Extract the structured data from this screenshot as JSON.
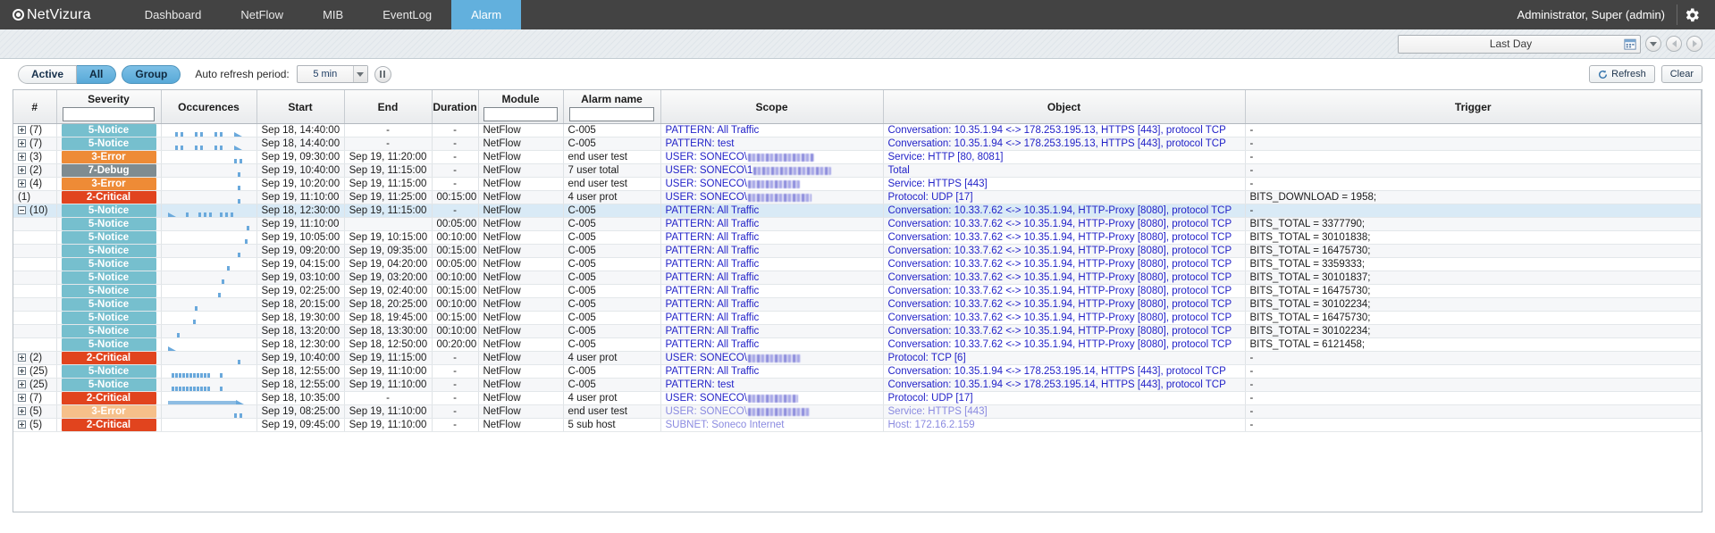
{
  "navbar": {
    "brand": "NetVizura",
    "logo_icon": "eye-logo-icon",
    "tabs": [
      {
        "label": "Dashboard",
        "active": false
      },
      {
        "label": "NetFlow",
        "active": false
      },
      {
        "label": "MIB",
        "active": false
      },
      {
        "label": "EventLog",
        "active": false
      },
      {
        "label": "Alarm",
        "active": true
      }
    ],
    "user": "Administrator, Super (admin)",
    "gear_icon": "gear-icon",
    "accent_color": "#62b0dd",
    "background_color": "#434343"
  },
  "subheader": {
    "time_range": "Last Day",
    "calendar_icon": "calendar-icon",
    "dropdown_icon": "chevron-down-icon",
    "prev_icon": "prev-arrow-icon",
    "next_icon": "next-arrow-icon"
  },
  "toolbar": {
    "filters": [
      {
        "label": "Active",
        "active": false
      },
      {
        "label": "All",
        "active": true
      },
      {
        "label": "Group",
        "active": true
      }
    ],
    "auto_refresh_label": "Auto refresh period:",
    "auto_refresh_value": "5 min",
    "pause_icon": "pause-icon",
    "refresh_button": "Refresh",
    "refresh_icon": "refresh-icon",
    "clear_button": "Clear"
  },
  "table": {
    "columns": [
      {
        "key": "num",
        "label": "#",
        "filter": false
      },
      {
        "key": "severity",
        "label": "Severity",
        "filter": true,
        "filter_value": ""
      },
      {
        "key": "occ",
        "label": "Occurences",
        "filter": false
      },
      {
        "key": "start",
        "label": "Start",
        "filter": false
      },
      {
        "key": "end",
        "label": "End",
        "filter": false
      },
      {
        "key": "duration",
        "label": "Duration",
        "filter": false
      },
      {
        "key": "module",
        "label": "Module",
        "filter": true,
        "filter_value": ""
      },
      {
        "key": "alarm",
        "label": "Alarm name",
        "filter": true,
        "filter_value": ""
      },
      {
        "key": "scope",
        "label": "Scope",
        "filter": false
      },
      {
        "key": "object",
        "label": "Object",
        "filter": false
      },
      {
        "key": "trigger",
        "label": "Trigger",
        "filter": false
      }
    ],
    "severity_colors": {
      "2-Critical": "#e1441e",
      "3-Error": "#ee8b36",
      "3-Error-light": "#f6c08a",
      "5-Notice": "#76bfce",
      "7-Debug": "#7f8c91"
    },
    "rows": [
      {
        "num": "(7)",
        "expandable": true,
        "child": false,
        "severity": "5-Notice",
        "sev_class": "sev-notice",
        "occ_pattern": "multi-arrow",
        "start": "Sep 18, 14:40:00",
        "end": "-",
        "duration": "-",
        "module": "NetFlow",
        "alarm": "C-005",
        "scope": "PATTERN: All Traffic",
        "scope_redacted": false,
        "object": "Conversation: 10.35.1.94 <-> 178.253.195.13, HTTPS [443], protocol TCP",
        "trigger": "-",
        "selected": false
      },
      {
        "num": "(7)",
        "expandable": true,
        "child": false,
        "severity": "5-Notice",
        "sev_class": "sev-notice",
        "occ_pattern": "multi-arrow",
        "start": "Sep 18, 14:40:00",
        "end": "-",
        "duration": "-",
        "module": "NetFlow",
        "alarm": "C-005",
        "scope": "PATTERN: test",
        "scope_redacted": false,
        "object": "Conversation: 10.35.1.94 <-> 178.253.195.13, HTTPS [443], protocol TCP",
        "trigger": "-",
        "selected": false
      },
      {
        "num": "(3)",
        "expandable": true,
        "child": false,
        "severity": "3-Error",
        "sev_class": "sev-error",
        "occ_pattern": "two-right",
        "start": "Sep 19, 09:30:00",
        "end": "Sep 19, 11:20:00",
        "duration": "-",
        "module": "NetFlow",
        "alarm": "end user test",
        "scope": "USER: SONECO\\",
        "scope_redacted": true,
        "object": "Service: HTTP [80, 8081]",
        "trigger": "-",
        "selected": false
      },
      {
        "num": "(2)",
        "expandable": true,
        "child": false,
        "severity": "7-Debug",
        "sev_class": "sev-debug",
        "occ_pattern": "one-right",
        "start": "Sep 19, 10:40:00",
        "end": "Sep 19, 11:15:00",
        "duration": "-",
        "module": "NetFlow",
        "alarm": "7 user total",
        "scope": "USER: SONECO\\1",
        "scope_redacted": true,
        "object": "Total",
        "trigger": "-",
        "selected": false
      },
      {
        "num": "(4)",
        "expandable": true,
        "child": false,
        "severity": "3-Error",
        "sev_class": "sev-error",
        "occ_pattern": "one-right",
        "start": "Sep 19, 10:20:00",
        "end": "Sep 19, 11:15:00",
        "duration": "-",
        "module": "NetFlow",
        "alarm": "end user test",
        "scope": "USER: SONECO\\",
        "scope_redacted": true,
        "object": "Service: HTTPS [443]",
        "trigger": "-",
        "selected": false
      },
      {
        "num": "(1)",
        "expandable": false,
        "child": false,
        "severity": "2-Critical",
        "sev_class": "sev-critical",
        "occ_pattern": "one-right",
        "start": "Sep 19, 11:10:00",
        "end": "Sep 19, 11:25:00",
        "duration": "00:15:00",
        "module": "NetFlow",
        "alarm": "4 user prot",
        "scope": "USER: SONECO\\",
        "scope_redacted": true,
        "object": "Protocol: UDP [17]",
        "trigger": "BITS_DOWNLOAD = 1958;",
        "selected": false
      },
      {
        "num": "(10)",
        "expandable": true,
        "expanded": true,
        "child": false,
        "severity": "5-Notice",
        "sev_class": "sev-notice",
        "occ_pattern": "dense-left",
        "start": "Sep 18, 12:30:00",
        "end": "Sep 19, 11:15:00",
        "duration": "-",
        "module": "NetFlow",
        "alarm": "C-005",
        "scope": "PATTERN: All Traffic",
        "scope_redacted": false,
        "object": "Conversation: 10.33.7.62 <-> 10.35.1.94, HTTP-Proxy [8080], protocol TCP",
        "trigger": "-",
        "selected": true
      },
      {
        "num": "",
        "expandable": false,
        "child": true,
        "severity": "5-Notice",
        "sev_class": "sev-notice",
        "occ_pattern": "tick-90",
        "start": "Sep 19, 11:10:00",
        "end": "",
        "duration": "00:05:00",
        "module": "NetFlow",
        "alarm": "C-005",
        "scope": "PATTERN: All Traffic",
        "scope_redacted": false,
        "object": "Conversation: 10.33.7.62 <-> 10.35.1.94, HTTP-Proxy [8080], protocol TCP",
        "trigger": "BITS_TOTAL = 3377790;",
        "selected": false
      },
      {
        "num": "",
        "expandable": false,
        "child": true,
        "severity": "5-Notice",
        "sev_class": "sev-notice",
        "occ_pattern": "tick-88",
        "start": "Sep 19, 10:05:00",
        "end": "Sep 19, 10:15:00",
        "duration": "00:10:00",
        "module": "NetFlow",
        "alarm": "C-005",
        "scope": "PATTERN: All Traffic",
        "scope_redacted": false,
        "object": "Conversation: 10.33.7.62 <-> 10.35.1.94, HTTP-Proxy [8080], protocol TCP",
        "trigger": "BITS_TOTAL = 30101838;",
        "selected": false
      },
      {
        "num": "",
        "expandable": false,
        "child": true,
        "severity": "5-Notice",
        "sev_class": "sev-notice",
        "occ_pattern": "tick-80",
        "start": "Sep 19, 09:20:00",
        "end": "Sep 19, 09:35:00",
        "duration": "00:15:00",
        "module": "NetFlow",
        "alarm": "C-005",
        "scope": "PATTERN: All Traffic",
        "scope_redacted": false,
        "object": "Conversation: 10.33.7.62 <-> 10.35.1.94, HTTP-Proxy [8080], protocol TCP",
        "trigger": "BITS_TOTAL = 16475730;",
        "selected": false
      },
      {
        "num": "",
        "expandable": false,
        "child": true,
        "severity": "5-Notice",
        "sev_class": "sev-notice",
        "occ_pattern": "tick-68",
        "start": "Sep 19, 04:15:00",
        "end": "Sep 19, 04:20:00",
        "duration": "00:05:00",
        "module": "NetFlow",
        "alarm": "C-005",
        "scope": "PATTERN: All Traffic",
        "scope_redacted": false,
        "object": "Conversation: 10.33.7.62 <-> 10.35.1.94, HTTP-Proxy [8080], protocol TCP",
        "trigger": "BITS_TOTAL = 3359333;",
        "selected": false
      },
      {
        "num": "",
        "expandable": false,
        "child": true,
        "severity": "5-Notice",
        "sev_class": "sev-notice",
        "occ_pattern": "tick-62",
        "start": "Sep 19, 03:10:00",
        "end": "Sep 19, 03:20:00",
        "duration": "00:10:00",
        "module": "NetFlow",
        "alarm": "C-005",
        "scope": "PATTERN: All Traffic",
        "scope_redacted": false,
        "object": "Conversation: 10.33.7.62 <-> 10.35.1.94, HTTP-Proxy [8080], protocol TCP",
        "trigger": "BITS_TOTAL = 30101837;",
        "selected": false
      },
      {
        "num": "",
        "expandable": false,
        "child": true,
        "severity": "5-Notice",
        "sev_class": "sev-notice",
        "occ_pattern": "tick-58",
        "start": "Sep 19, 02:25:00",
        "end": "Sep 19, 02:40:00",
        "duration": "00:15:00",
        "module": "NetFlow",
        "alarm": "C-005",
        "scope": "PATTERN: All Traffic",
        "scope_redacted": false,
        "object": "Conversation: 10.33.7.62 <-> 10.35.1.94, HTTP-Proxy [8080], protocol TCP",
        "trigger": "BITS_TOTAL = 16475730;",
        "selected": false
      },
      {
        "num": "",
        "expandable": false,
        "child": true,
        "severity": "5-Notice",
        "sev_class": "sev-notice",
        "occ_pattern": "tick-32",
        "start": "Sep 18, 20:15:00",
        "end": "Sep 18, 20:25:00",
        "duration": "00:10:00",
        "module": "NetFlow",
        "alarm": "C-005",
        "scope": "PATTERN: All Traffic",
        "scope_redacted": false,
        "object": "Conversation: 10.33.7.62 <-> 10.35.1.94, HTTP-Proxy [8080], protocol TCP",
        "trigger": "BITS_TOTAL = 30102234;",
        "selected": false
      },
      {
        "num": "",
        "expandable": false,
        "child": true,
        "severity": "5-Notice",
        "sev_class": "sev-notice",
        "occ_pattern": "tick-30",
        "start": "Sep 18, 19:30:00",
        "end": "Sep 18, 19:45:00",
        "duration": "00:15:00",
        "module": "NetFlow",
        "alarm": "C-005",
        "scope": "PATTERN: All Traffic",
        "scope_redacted": false,
        "object": "Conversation: 10.33.7.62 <-> 10.35.1.94, HTTP-Proxy [8080], protocol TCP",
        "trigger": "BITS_TOTAL = 16475730;",
        "selected": false
      },
      {
        "num": "",
        "expandable": false,
        "child": true,
        "severity": "5-Notice",
        "sev_class": "sev-notice",
        "occ_pattern": "tick-12",
        "start": "Sep 18, 13:20:00",
        "end": "Sep 18, 13:30:00",
        "duration": "00:10:00",
        "module": "NetFlow",
        "alarm": "C-005",
        "scope": "PATTERN: All Traffic",
        "scope_redacted": false,
        "object": "Conversation: 10.33.7.62 <-> 10.35.1.94, HTTP-Proxy [8080], protocol TCP",
        "trigger": "BITS_TOTAL = 30102234;",
        "selected": false
      },
      {
        "num": "",
        "expandable": false,
        "child": true,
        "severity": "5-Notice",
        "sev_class": "sev-notice",
        "occ_pattern": "arrow-left",
        "start": "Sep 18, 12:30:00",
        "end": "Sep 18, 12:50:00",
        "duration": "00:20:00",
        "module": "NetFlow",
        "alarm": "C-005",
        "scope": "PATTERN: All Traffic",
        "scope_redacted": false,
        "object": "Conversation: 10.33.7.62 <-> 10.35.1.94, HTTP-Proxy [8080], protocol TCP",
        "trigger": "BITS_TOTAL = 6121458;",
        "selected": false
      },
      {
        "num": "(2)",
        "expandable": true,
        "child": false,
        "severity": "2-Critical",
        "sev_class": "sev-critical",
        "occ_pattern": "one-right",
        "start": "Sep 19, 10:40:00",
        "end": "Sep 19, 11:15:00",
        "duration": "-",
        "module": "NetFlow",
        "alarm": "4 user prot",
        "scope": "USER: SONECO\\",
        "scope_redacted": true,
        "object": "Protocol: TCP [6]",
        "trigger": "-",
        "selected": false
      },
      {
        "num": "(25)",
        "expandable": true,
        "child": false,
        "severity": "5-Notice",
        "sev_class": "sev-notice",
        "occ_pattern": "dense-bars",
        "start": "Sep 18, 12:55:00",
        "end": "Sep 19, 11:10:00",
        "duration": "-",
        "module": "NetFlow",
        "alarm": "C-005",
        "scope": "PATTERN: All Traffic",
        "scope_redacted": false,
        "object": "Conversation: 10.35.1.94 <-> 178.253.195.14, HTTPS [443], protocol TCP",
        "trigger": "-",
        "selected": false
      },
      {
        "num": "(25)",
        "expandable": true,
        "child": false,
        "severity": "5-Notice",
        "sev_class": "sev-notice",
        "occ_pattern": "dense-bars",
        "start": "Sep 18, 12:55:00",
        "end": "Sep 19, 11:10:00",
        "duration": "-",
        "module": "NetFlow",
        "alarm": "C-005",
        "scope": "PATTERN: test",
        "scope_redacted": false,
        "object": "Conversation: 10.35.1.94 <-> 178.253.195.14, HTTPS [443], protocol TCP",
        "trigger": "-",
        "selected": false
      },
      {
        "num": "(7)",
        "expandable": true,
        "child": false,
        "severity": "2-Critical",
        "sev_class": "sev-critical",
        "occ_pattern": "long-bar",
        "start": "Sep 18, 10:35:00",
        "end": "-",
        "duration": "-",
        "module": "NetFlow",
        "alarm": "4 user prot",
        "scope": "USER: SONECO\\",
        "scope_redacted": true,
        "object": "Protocol: UDP [17]",
        "trigger": "-",
        "selected": false
      },
      {
        "num": "(5)",
        "expandable": true,
        "child": false,
        "severity": "3-Error",
        "sev_class": "sev-error-lt",
        "occ_pattern": "two-right",
        "start": "Sep 19, 08:25:00",
        "end": "Sep 19, 11:10:00",
        "duration": "-",
        "module": "NetFlow",
        "alarm": "end user test",
        "scope": "USER: SONECO\\",
        "scope_redacted": true,
        "object": "Service: HTTPS [443]",
        "trigger": "-",
        "selected": false,
        "dim": true
      },
      {
        "num": "(5)",
        "expandable": true,
        "child": false,
        "severity": "2-Critical",
        "sev_class": "sev-critical",
        "occ_pattern": "none",
        "start": "Sep 19, 09:45:00",
        "end": "Sep 19, 11:10:00",
        "duration": "-",
        "module": "NetFlow",
        "alarm": "5 sub host",
        "scope": "SUBNET: Soneco Internet",
        "scope_redacted": false,
        "object": "Host: 172.16.2.159",
        "trigger": "-",
        "selected": false,
        "dim": true,
        "clipped": true
      }
    ]
  }
}
